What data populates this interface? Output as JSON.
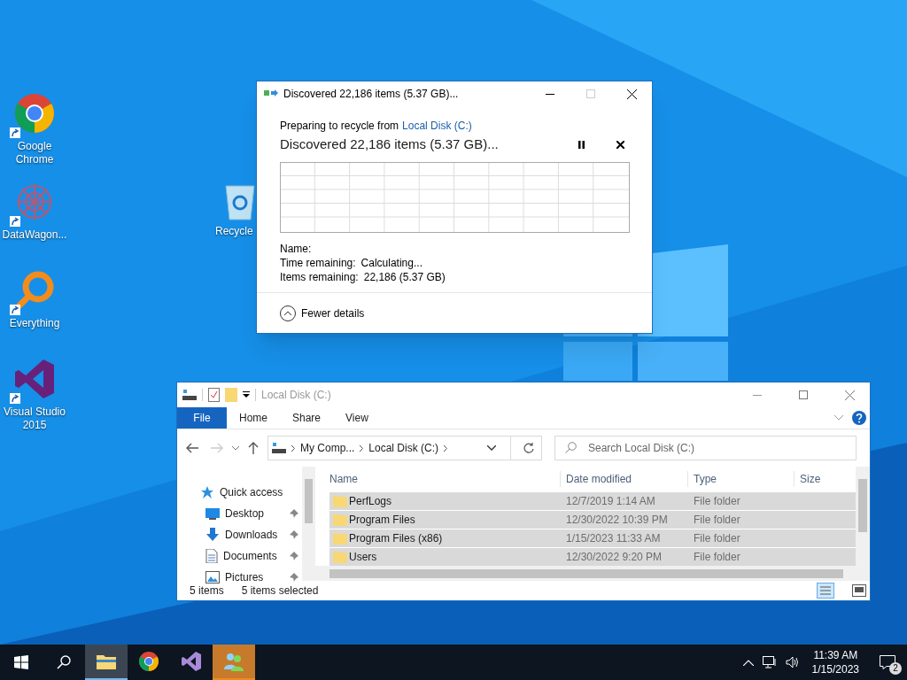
{
  "desktop": {
    "icons": [
      {
        "kind": "chrome",
        "label": "Google Chrome"
      },
      {
        "kind": "datawagon",
        "label": "DataWagon..."
      },
      {
        "kind": "everything",
        "label": "Everything"
      },
      {
        "kind": "vs",
        "label": "Visual Studio 2015"
      }
    ],
    "recycle_bin": {
      "label": "Recycle"
    }
  },
  "copy_dialog": {
    "title": "Discovered 22,186 items (5.37 GB)...",
    "subtitle": "Preparing to recycle from",
    "source_link": "Local Disk (C:)",
    "heading": "Discovered 22,186 items (5.37 GB)...",
    "details": [
      {
        "label": "Name:"
      },
      {
        "label": "Time remaining:",
        "value": "Calculating..."
      },
      {
        "label": "Items remaining:",
        "value": "22,186 (5.37 GB)"
      }
    ],
    "toggle": "Fewer details"
  },
  "explorer": {
    "title": "Local Disk (C:)",
    "ribbon_tabs": [
      {
        "label": "File",
        "selected": true
      },
      {
        "label": "Home",
        "selected": false
      },
      {
        "label": "Share",
        "selected": false
      },
      {
        "label": "View",
        "selected": false
      }
    ],
    "breadcrumb": [
      "My Comp...",
      "Local Disk (C:)"
    ],
    "search": {
      "placeholder": "Search Local Disk (C:)"
    },
    "nav": [
      {
        "label": "Quick access",
        "kind": "star",
        "pinned": false
      },
      {
        "label": "Desktop",
        "kind": "desktop",
        "pinned": true
      },
      {
        "label": "Downloads",
        "kind": "download",
        "pinned": true
      },
      {
        "label": "Documents",
        "kind": "document",
        "pinned": true
      },
      {
        "label": "Pictures",
        "kind": "pictures",
        "pinned": true
      }
    ],
    "columns": [
      "Name",
      "Date modified",
      "Type",
      "Size"
    ],
    "rows": [
      {
        "name": "PerfLogs",
        "date": "12/7/2019 1:14 AM",
        "type": "File folder",
        "selected": true
      },
      {
        "name": "Program Files",
        "date": "12/30/2022 10:39 PM",
        "type": "File folder",
        "selected": true
      },
      {
        "name": "Program Files (x86)",
        "date": "1/15/2023 11:33 AM",
        "type": "File folder",
        "selected": true
      },
      {
        "name": "Users",
        "date": "12/30/2022 9:20 PM",
        "type": "File folder",
        "selected": true
      }
    ],
    "status": {
      "count": "5 items",
      "selected": "5 items selected"
    }
  },
  "taskbar": {
    "apps": [
      {
        "kind": "explorer",
        "active": true,
        "flashing": false
      },
      {
        "kind": "chrome",
        "active": false,
        "flashing": false
      },
      {
        "kind": "vs",
        "active": false,
        "flashing": false
      },
      {
        "kind": "people",
        "active": false,
        "flashing": true
      }
    ],
    "time": "11:39 AM",
    "date": "1/15/2023",
    "notifications": "2"
  }
}
